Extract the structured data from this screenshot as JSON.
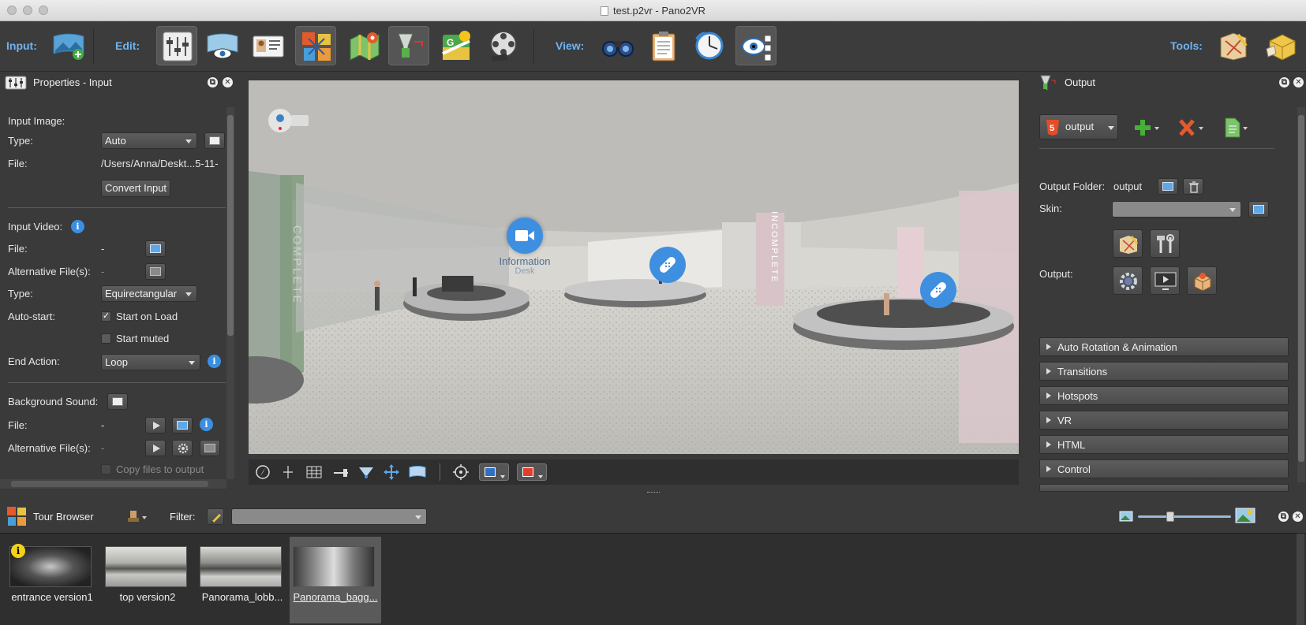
{
  "window": {
    "title": "test.p2vr - Pano2VR"
  },
  "toolbar": {
    "input_label": "Input:",
    "edit_label": "Edit:",
    "view_label": "View:",
    "tools_label": "Tools:"
  },
  "properties": {
    "title": "Properties - Input",
    "input_image_heading": "Input Image:",
    "type_label": "Type:",
    "type_value": "Auto",
    "file_label": "File:",
    "file_value": "/Users/Anna/Deskt...5-11-",
    "convert_button": "Convert Input",
    "input_video_heading": "Input Video:",
    "video_file_label": "File:",
    "video_file_value": "-",
    "video_alt_label": "Alternative File(s):",
    "video_alt_value": "-",
    "video_type_label": "Type:",
    "video_type_value": "Equirectangular",
    "autostart_label": "Auto-start:",
    "start_on_load": "Start on Load",
    "start_muted": "Start muted",
    "end_action_label": "End Action:",
    "end_action_value": "Loop",
    "bg_sound_label": "Background Sound:",
    "sound_file_label": "File:",
    "sound_file_value": "-",
    "sound_alt_label": "Alternative File(s):",
    "sound_alt_value": "-",
    "copy_files": "Copy files to output"
  },
  "viewport": {
    "hotspot_label": "Information",
    "hotspot_sublabel": "Desk",
    "pillar_left_text": "COMPLETE",
    "pillar_right_text": "INCOMPLETE"
  },
  "output": {
    "title": "Output",
    "selector": "output",
    "folder_label": "Output Folder:",
    "folder_value": "output",
    "skin_label": "Skin:",
    "output_label": "Output:",
    "sections": [
      "Auto Rotation & Animation",
      "Transitions",
      "Hotspots",
      "VR",
      "HTML",
      "Control"
    ]
  },
  "tour_browser": {
    "title": "Tour Browser",
    "filter_label": "Filter:",
    "items": [
      {
        "caption": "entrance version1",
        "selected": false,
        "info_badge": "i"
      },
      {
        "caption": "top version2",
        "selected": false
      },
      {
        "caption": "Panorama_lobb...",
        "selected": false
      },
      {
        "caption": "Panorama_bagg...",
        "selected": true
      }
    ]
  },
  "colors": {
    "accent_blue": "#6fb4f0",
    "panel_bg": "#3a3a3a",
    "hotspot_blue": "#3f8fe0"
  },
  "icons": {
    "input": "panorama-add-icon",
    "edit": [
      "sliders-icon",
      "eye-pano-icon",
      "id-card-icon",
      "tour-map-icon",
      "map-pin-icon",
      "output-funnel-icon",
      "google-street-view-icon",
      "film-reel-icon"
    ],
    "view": [
      "binoculars-icon",
      "clipboard-icon",
      "clock-compass-icon",
      "eye-check-icon"
    ],
    "tools": [
      "tool-sticky-icon",
      "tool-package-icon"
    ]
  }
}
